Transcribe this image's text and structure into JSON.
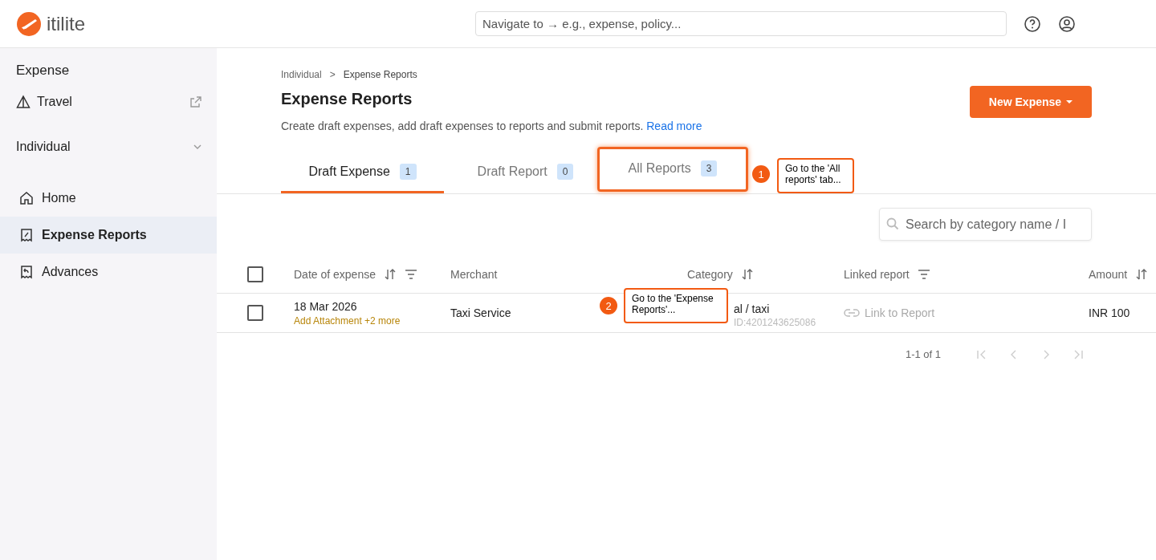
{
  "header": {
    "logo": "itilite",
    "search": {
      "placeholder": "Navigate to → e.g., expense, policy..."
    }
  },
  "sidebar": {
    "section": "Expense",
    "travel": "Travel",
    "group": {
      "label": "Individual",
      "expanded": true
    },
    "items": [
      {
        "label": "Home",
        "selected": false
      },
      {
        "label": "Expense Reports",
        "selected": true
      },
      {
        "label": "Advances",
        "selected": false
      }
    ]
  },
  "breadcrumb": {
    "items": [
      "Individual",
      "Expense Reports"
    ],
    "separator": ">"
  },
  "page": {
    "title": "Expense Reports",
    "description": "Create draft expenses, add draft expenses to reports and submit reports.",
    "link": "Read more",
    "new_button": "New Expense"
  },
  "tabs": [
    {
      "label": "Draft Expense",
      "count": "1",
      "selected": true,
      "highlighted": false
    },
    {
      "label": "Draft Report",
      "count": "0",
      "selected": false,
      "highlighted": false
    },
    {
      "label": "All Reports",
      "count": "3",
      "selected": false,
      "highlighted": true
    }
  ],
  "table_search": {
    "placeholder": "Search by category name / I"
  },
  "table": {
    "select_all": {
      "checked": false
    },
    "columns": [
      {
        "label": "Date of expense",
        "kind": "sort_filter"
      },
      {
        "label": "Merchant",
        "kind": "plain"
      },
      {
        "label": "Category",
        "kind": "sort"
      },
      {
        "label": "Linked report",
        "kind": "filter"
      },
      {
        "label": "Amount",
        "kind": "sort"
      }
    ],
    "rows": [
      {
        "checked": false,
        "date": "18 Mar 2026",
        "attachment": "Add Attachment +2 more",
        "merchant": "Taxi Service",
        "category": "al / taxi",
        "category_id": "ID:4201243625086",
        "linked": "Link to Report",
        "amount": "INR 100"
      }
    ]
  },
  "pagination": {
    "range": "1-1 of 1"
  },
  "annotations": [
    {
      "number": "1",
      "text": "Go to the 'All reports' tab..."
    },
    {
      "number": "2",
      "text": "Go to the 'Expense Reports'..."
    }
  ]
}
